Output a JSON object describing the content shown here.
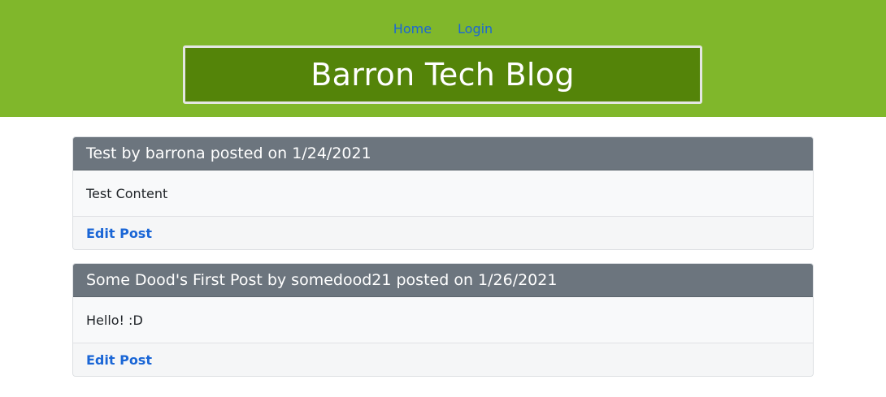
{
  "nav": {
    "home_label": "Home",
    "login_label": "Login"
  },
  "header": {
    "title": "Barron Tech Blog"
  },
  "posts": [
    {
      "heading": "Test by barrona posted on 1/24/2021",
      "content": "Test Content",
      "edit_label": "Edit Post"
    },
    {
      "heading": "Some Dood's First Post by somedood21 posted on 1/26/2021",
      "content": "Hello! :D",
      "edit_label": "Edit Post"
    }
  ],
  "colors": {
    "header_bg": "#80b72b",
    "title_bg": "#548409",
    "post_header_bg": "#6c757e",
    "link": "#1a66d6"
  }
}
